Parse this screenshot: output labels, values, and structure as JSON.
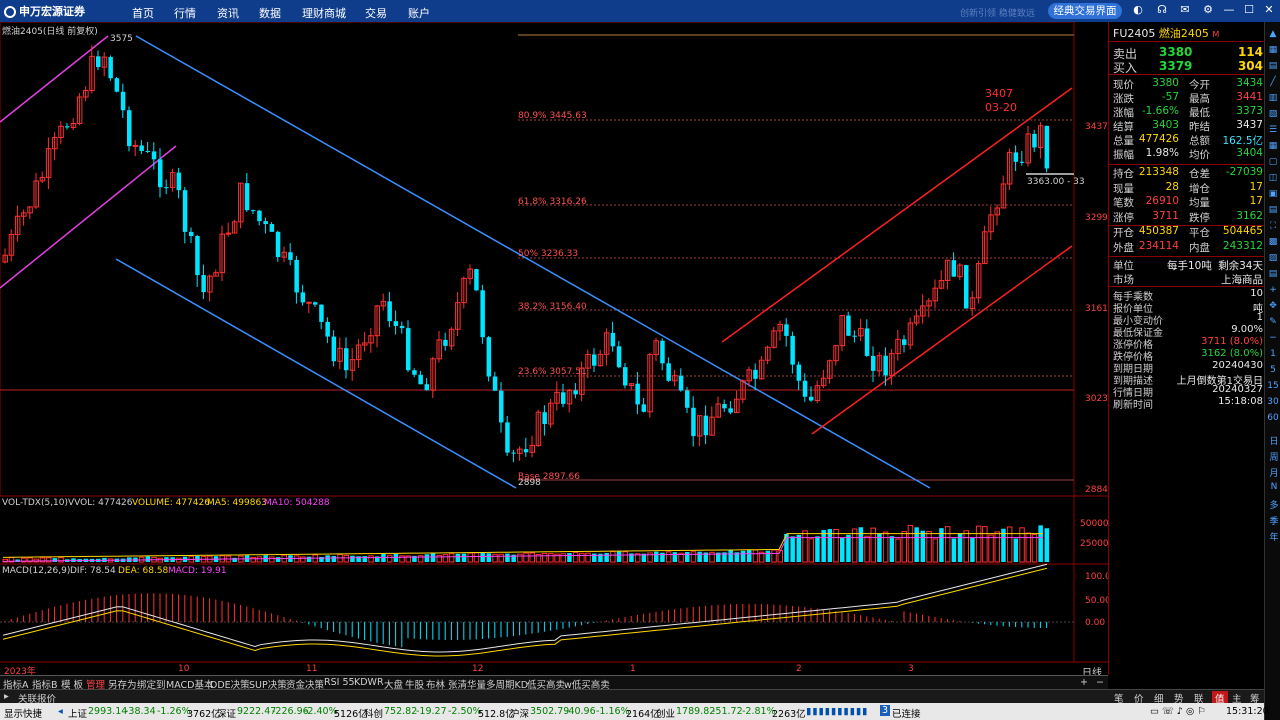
{
  "app": {
    "logo_text": "申万宏源证券",
    "nav": [
      "首页",
      "行情",
      "资讯",
      "数据",
      "理财商城",
      "交易",
      "账户"
    ],
    "classic_button": "经典交易界面",
    "slogan": "创新引领 稳健致远"
  },
  "chart": {
    "title": "燃油2405(日线 前复权)",
    "price_labels": [
      "3437",
      "3299",
      "3161",
      "3023",
      "2884"
    ],
    "high_label": "3575",
    "low_label": "2898",
    "annotation_price": "3407",
    "annotation_date": "03-20",
    "current_marker": "3363.00 - 33",
    "fib_levels": [
      {
        "label": "80.9% 3445.63"
      },
      {
        "label": "61.8% 3316.26"
      },
      {
        "label": "50% 3236.33"
      },
      {
        "label": "38.2% 3156.40"
      },
      {
        "label": "23.6% 3057.51"
      },
      {
        "label": "Base 2897.66"
      }
    ],
    "time_labels": [
      "2023年",
      "10",
      "11",
      "12",
      "1",
      "2",
      "3"
    ],
    "period_label": "日线"
  },
  "vol": {
    "header_name": "VOL-TDX(5,10)",
    "vvol": "VVOL: 477426",
    "volume": "VOLUME: 477426",
    "ma5": "MA5: 499863",
    "ma10": "MA10: 504288",
    "axis": [
      "50000",
      "25000"
    ]
  },
  "macd": {
    "header_name": "MACD(12,26,9)",
    "dif": "DIF: 78.54",
    "dea": "DEA: 68.58",
    "macd": "MACD: 19.91",
    "axis": [
      "100.0",
      "50.00",
      "0.00"
    ]
  },
  "quote": {
    "symbol": "FU2405",
    "name": "燃油2405",
    "tag": "M",
    "sell_label": "卖出",
    "sell_price": "3380",
    "sell_vol": "114",
    "buy_label": "买入",
    "buy_price": "3379",
    "buy_vol": "304",
    "rows": [
      {
        "l1": "现价",
        "v1": "3380",
        "c1": "grn",
        "l2": "今开",
        "v2": "3434",
        "c2": "grn"
      },
      {
        "l1": "涨跌",
        "v1": "-57",
        "c1": "grn",
        "l2": "最高",
        "v2": "3441",
        "c2": "red"
      },
      {
        "l1": "涨幅",
        "v1": "-1.66%",
        "c1": "grn",
        "l2": "最低",
        "v2": "3373",
        "c2": "grn"
      },
      {
        "l1": "结算",
        "v1": "3403",
        "c1": "grn",
        "l2": "昨结",
        "v2": "3437",
        "c2": "wht"
      },
      {
        "l1": "总量",
        "v1": "477426",
        "c1": "yel",
        "l2": "总额",
        "v2": "162.5亿",
        "c2": "cyan"
      },
      {
        "l1": "振幅",
        "v1": "1.98%",
        "c1": "wht",
        "l2": "均价",
        "v2": "3404",
        "c2": "grn"
      }
    ],
    "rows2": [
      {
        "l1": "持仓",
        "v1": "213348",
        "c1": "yel",
        "l2": "仓差",
        "v2": "-27039",
        "c2": "grn"
      },
      {
        "l1": "现量",
        "v1": "28",
        "c1": "yel",
        "l2": "增仓",
        "v2": "17",
        "c2": "yel"
      },
      {
        "l1": "笔数",
        "v1": "26910",
        "c1": "red",
        "l2": "均量",
        "v2": "17",
        "c2": "yel"
      },
      {
        "l1": "涨停",
        "v1": "3711",
        "c1": "red",
        "l2": "跌停",
        "v2": "3162",
        "c2": "grn"
      }
    ],
    "rows3": [
      {
        "l1": "开仓",
        "v1": "450387",
        "c1": "yel",
        "l2": "平仓",
        "v2": "504465",
        "c2": "yel"
      },
      {
        "l1": "外盘",
        "v1": "234114",
        "c1": "red",
        "l2": "内盘",
        "v2": "243312",
        "c2": "grn"
      }
    ],
    "unit_label": "单位",
    "unit_value": "每手10吨",
    "remain": "剩余34天",
    "market_label": "市场",
    "market_value": "上海商品",
    "details": [
      {
        "k": "每手乘数",
        "v": "10",
        "c": "wht"
      },
      {
        "k": "报价单位",
        "v": "吨",
        "c": "wht"
      },
      {
        "k": "最小变动价",
        "v": "1",
        "c": "wht"
      },
      {
        "k": "最低保证金",
        "v": "9.00%",
        "c": "wht"
      },
      {
        "k": "涨停价格",
        "v": "3711 (8.0%)",
        "c": "red"
      },
      {
        "k": "跌停价格",
        "v": "3162 (8.0%)",
        "c": "grn"
      },
      {
        "k": "到期日期",
        "v": "20240430",
        "c": "wht"
      },
      {
        "k": "到期描述",
        "v": "上月倒数第1交易日",
        "c": "wht"
      },
      {
        "k": "行情日期",
        "v": "20240327",
        "c": "wht"
      },
      {
        "k": "刷新时间",
        "v": "15:18:08",
        "c": "wht"
      }
    ]
  },
  "right_toolbar_text": [
    "日",
    "周",
    "月",
    "N",
    "多",
    "季",
    "年"
  ],
  "bottom_tabs": [
    "指标A",
    "指标B",
    "模 板",
    "管理",
    "另存为",
    "绑定到",
    "MACD基本",
    "DDE决策",
    "SUP决策",
    "资金决策",
    "RSI 55",
    "KDWR",
    "大盘",
    "牛股",
    "布林",
    "张清华量",
    "多周期KD",
    "低买高卖",
    "w低买高卖"
  ],
  "alert_label": "关联报价",
  "rp_tabs": [
    "笔",
    "价",
    "细",
    "势",
    "联",
    "值",
    "主",
    "筹"
  ],
  "status": {
    "quick": "显示快捷",
    "sh_label": "上证",
    "sh": "2993.14",
    "sh_chg": "-38.34",
    "sh_pct": "-1.26%",
    "sh_amt": "3762亿",
    "sz_label": "深证",
    "sz": "9222.47",
    "sz_chg": "-226.96",
    "sz_pct": "-2.40%",
    "sz_amt": "5126亿",
    "kc_label": "科创",
    "kc": "752.82",
    "kc_chg": "-19.27",
    "kc_pct": "-2.50%",
    "kc_amt": "512.8亿",
    "hs_label": "沪深",
    "hs": "3502.79",
    "hs_chg": "-40.96",
    "hs_pct": "-1.16%",
    "hs_amt": "2164亿",
    "cy_label": "创业",
    "cy": "1789.82",
    "cy_chg": "-51.72",
    "cy_pct": "-2.81%",
    "cy_amt": "2263亿",
    "connected": "已连接",
    "conn_num": "3",
    "time": "15:31:20"
  }
}
